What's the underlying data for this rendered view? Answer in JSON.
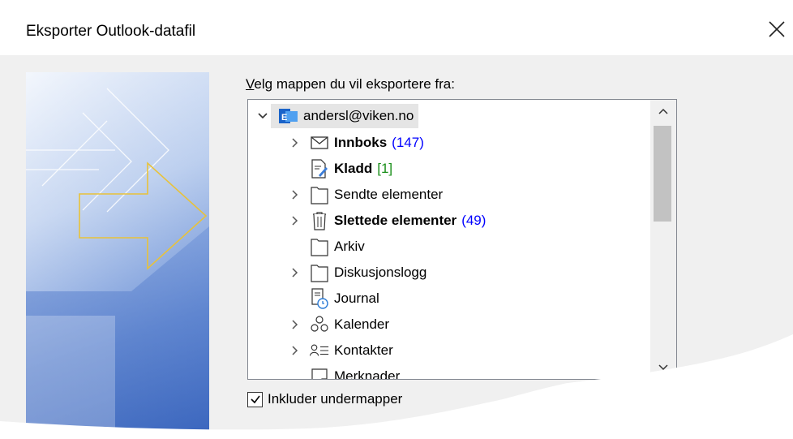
{
  "dialog": {
    "title": "Eksporter Outlook-datafil",
    "prompt_text": "Velg mappen du vil eksportere fra:",
    "include_subfolders_label": "Inkluder undermapper",
    "include_subfolders_checked": true
  },
  "tree": {
    "account": {
      "label": "andersl@viken.no",
      "icon": "exchange-account-icon",
      "expanded": true,
      "selected": true
    },
    "items": [
      {
        "label": "Innboks",
        "icon": "mail-icon",
        "bold": true,
        "count": "(147)",
        "count_color": "#0000ff",
        "expandable": true
      },
      {
        "label": "Kladd",
        "icon": "draft-icon",
        "bold": true,
        "count": "[1]",
        "count_color": "#1a8f1a",
        "expandable": false
      },
      {
        "label": "Sendte elementer",
        "icon": "folder-icon",
        "bold": false,
        "count": "",
        "expandable": true
      },
      {
        "label": "Slettede elementer",
        "icon": "trash-icon",
        "bold": true,
        "count": "(49)",
        "count_color": "#0000ff",
        "expandable": true
      },
      {
        "label": "Arkiv",
        "icon": "folder-icon",
        "bold": false,
        "count": "",
        "expandable": false
      },
      {
        "label": "Diskusjonslogg",
        "icon": "folder-icon",
        "bold": false,
        "count": "",
        "expandable": true
      },
      {
        "label": "Journal",
        "icon": "journal-icon",
        "bold": false,
        "count": "",
        "expandable": false
      },
      {
        "label": "Kalender",
        "icon": "calendar-icon",
        "bold": false,
        "count": "",
        "expandable": true
      },
      {
        "label": "Kontakter",
        "icon": "contacts-icon",
        "bold": false,
        "count": "",
        "expandable": true
      },
      {
        "label": "Merknader",
        "icon": "notes-icon",
        "bold": false,
        "count": "",
        "expandable": false
      }
    ]
  },
  "colors": {
    "dialog_bg": "#f0f0f0",
    "accent_blue": "#0078d4",
    "gold_arrow": "#e8c23a"
  }
}
